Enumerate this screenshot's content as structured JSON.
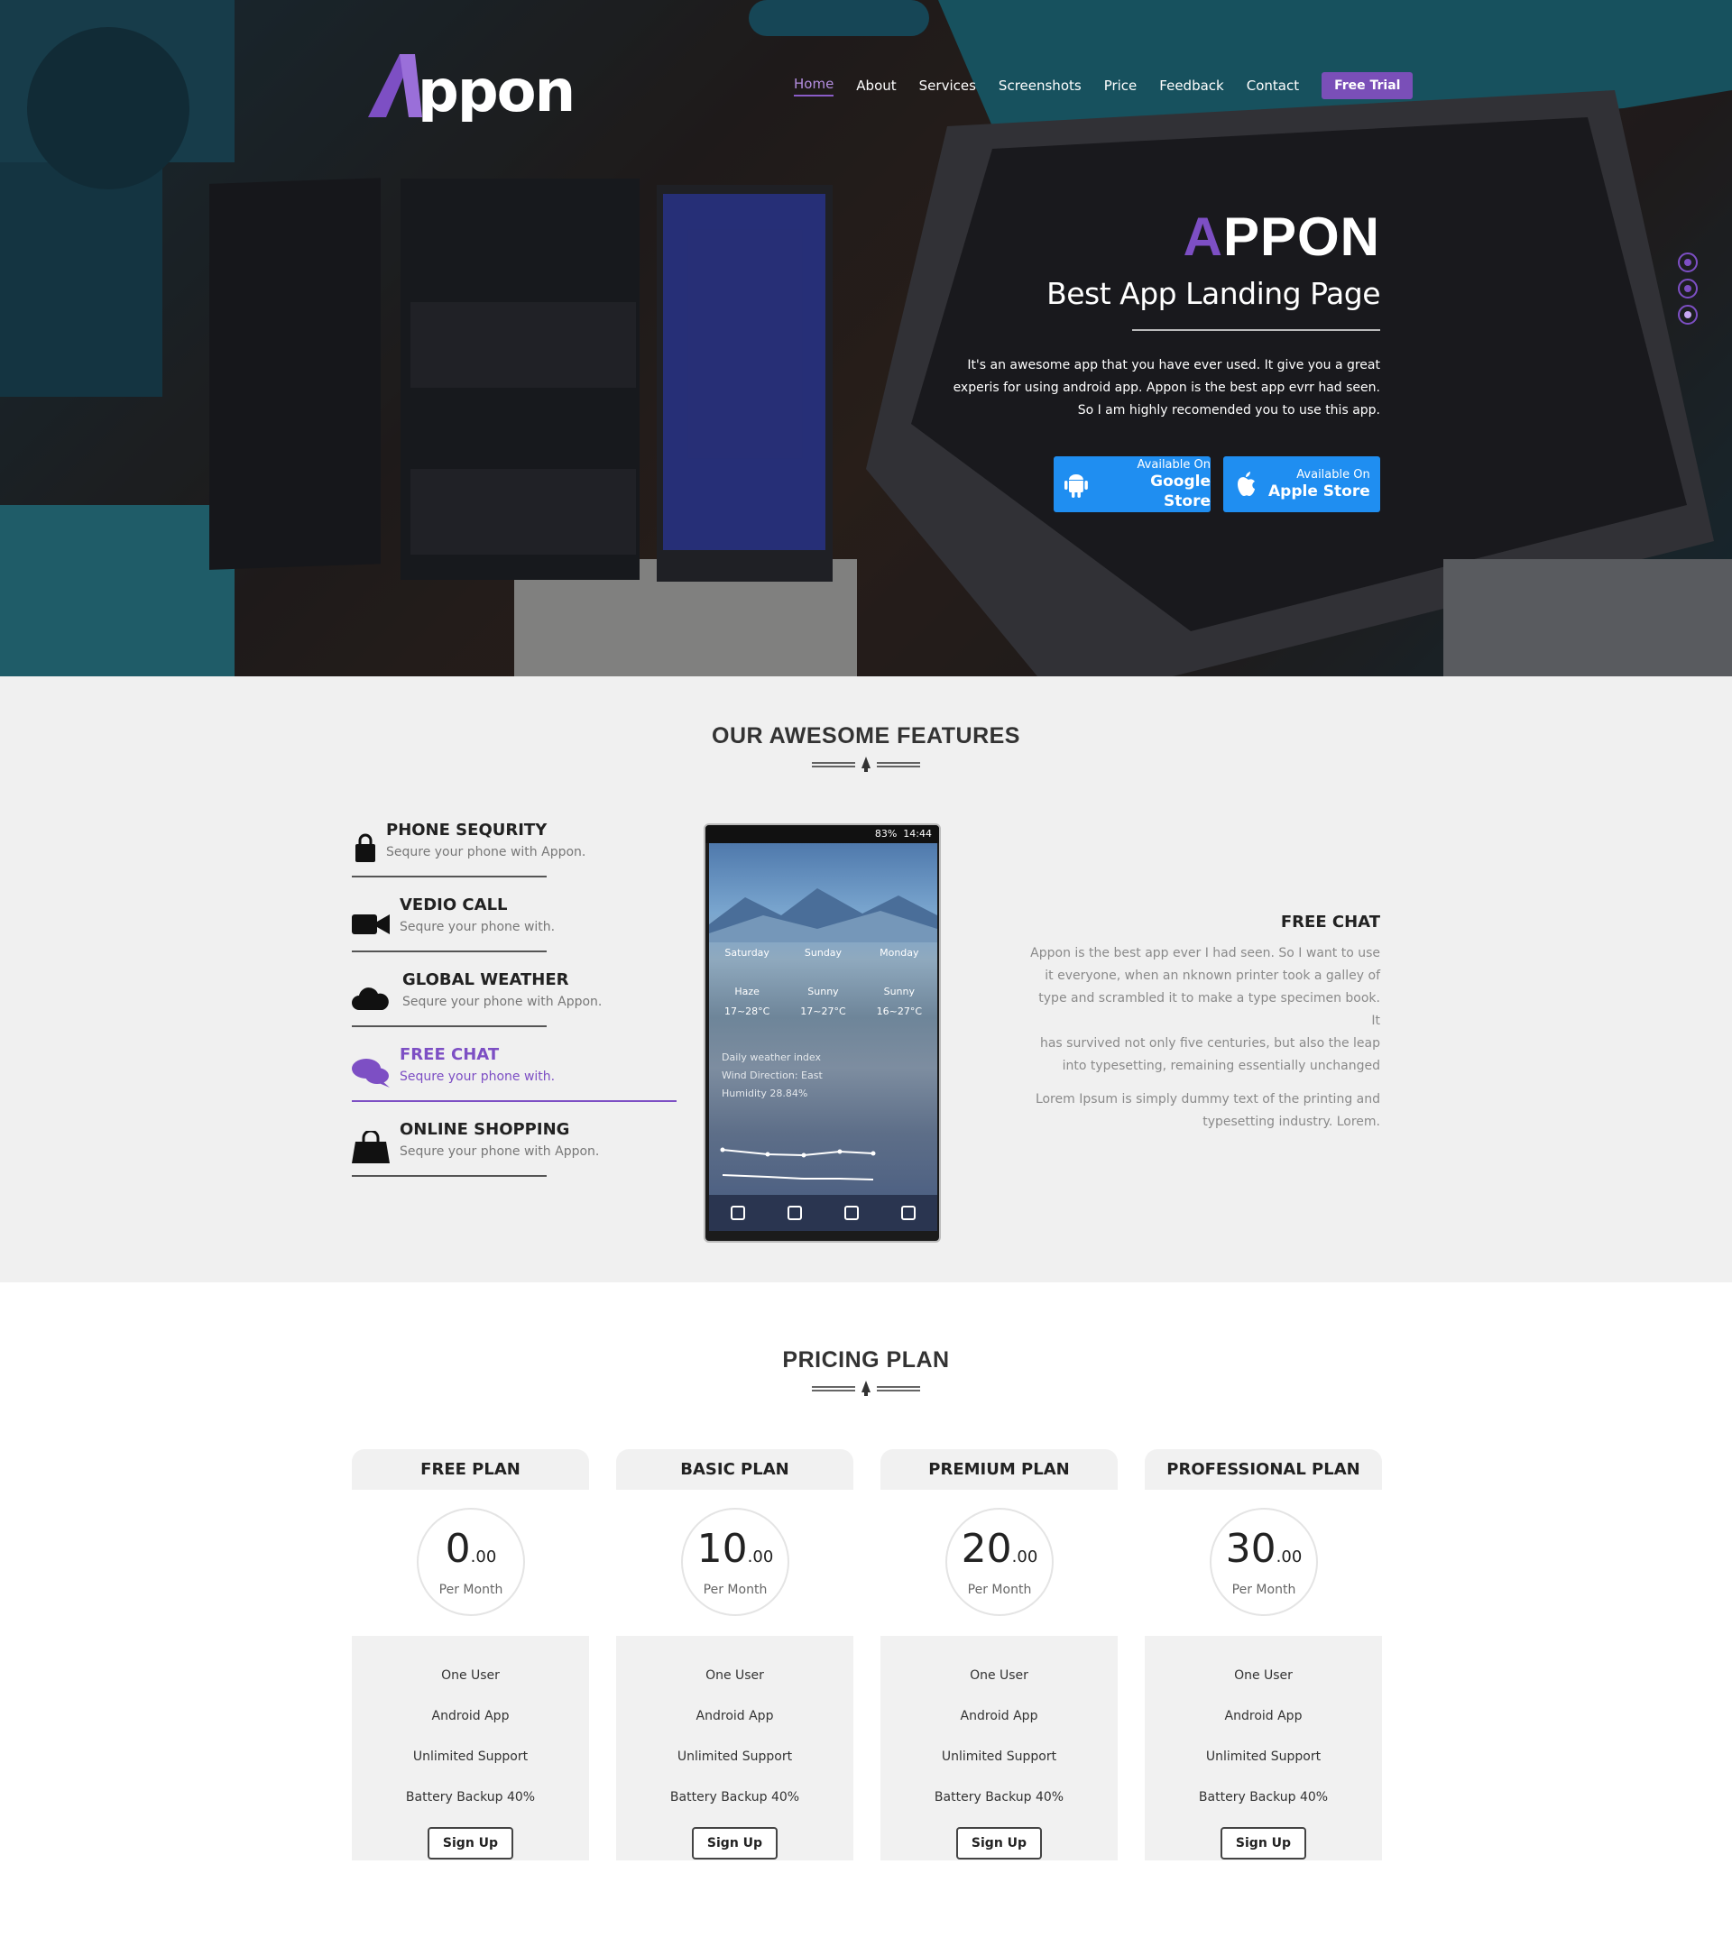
{
  "brand": {
    "logo_text": "Appon"
  },
  "nav": {
    "items": [
      "Home",
      "About",
      "Services",
      "Screenshots",
      "Price",
      "Feedback",
      "Contact"
    ],
    "active": "Home",
    "cta": "Free Trial"
  },
  "hero": {
    "title_accent": "A",
    "title_rest": "PPON",
    "subtitle": "Best App Landing Page",
    "text_line1": "It's an awesome app that you have ever used. It give you a great",
    "text_line2": "experis for using android app. Appon is the best app evrr had seen.",
    "text_line3": "So I am highly recomended you to use this app.",
    "google_small": "Available On",
    "google_big": "Google Store",
    "apple_small": "Available On",
    "apple_big": "Apple Store",
    "slider_active": 3
  },
  "features": {
    "title": "OUR AWESOME FEATURES",
    "items": [
      {
        "title": "PHONE SEQURITY",
        "desc": "Sequre your phone with Appon.",
        "icon": "lock-icon"
      },
      {
        "title": "VEDIO CALL",
        "desc": "Sequre your phone with.",
        "icon": "video-camera-icon"
      },
      {
        "title": "GLOBAL WEATHER",
        "desc": "Sequre your phone with Appon.",
        "icon": "cloud-icon"
      },
      {
        "title": "FREE CHAT",
        "desc": "Sequre your phone with.",
        "icon": "chat-bubbles-icon"
      },
      {
        "title": "ONLINE SHOPPING",
        "desc": "Sequre your phone with Appon.",
        "icon": "shopping-bag-icon"
      }
    ],
    "active_index": 3,
    "accent_color": "#7d4fc4",
    "phone": {
      "status_battery": "83%",
      "status_time": "14:44",
      "days": [
        "Saturday",
        "Sunday",
        "Monday"
      ],
      "conditions": [
        "Haze",
        "Sunny",
        "Sunny"
      ],
      "temps": [
        "17~28°C",
        "17~27°C",
        "16~27°C"
      ],
      "index_title": "Daily weather index",
      "wind": "Wind Direction: East",
      "humidity": "Humidity 28.84%"
    },
    "detail": {
      "title": "FREE CHAT",
      "para1_l1": "Appon is the best app ever I had seen. So I want to use",
      "para1_l2": "it everyone, when an nknown printer took a galley of",
      "para1_l3": "type and scrambled it to make a type specimen book. It",
      "para1_l4": "has survived not only five centuries, but also the leap",
      "para1_l5": "into typesetting, remaining essentially unchanged",
      "para2_l1": "Lorem Ipsum is simply dummy text of the printing and",
      "para2_l2": "typesetting industry. Lorem."
    }
  },
  "pricing": {
    "title": "PRICING PLAN",
    "plans": [
      {
        "name": "FREE PLAN",
        "price": "0",
        "cents": ".00",
        "period": "Per Month"
      },
      {
        "name": "BASIC PLAN",
        "price": "10",
        "cents": ".00",
        "period": "Per Month"
      },
      {
        "name": "PREMIUM PLAN",
        "price": "20",
        "cents": ".00",
        "period": "Per Month"
      },
      {
        "name": "PROFESSIONAL PLAN",
        "price": "30",
        "cents": ".00",
        "period": "Per Month"
      }
    ],
    "features": [
      "One User",
      "Android App",
      "Unlimited Support",
      "Battery Backup 40%"
    ],
    "signup_label": "Sign Up"
  },
  "colors": {
    "accent": "#7d4fc4",
    "store_button": "#1f8ef1",
    "features_bg": "#f0f0f0"
  }
}
